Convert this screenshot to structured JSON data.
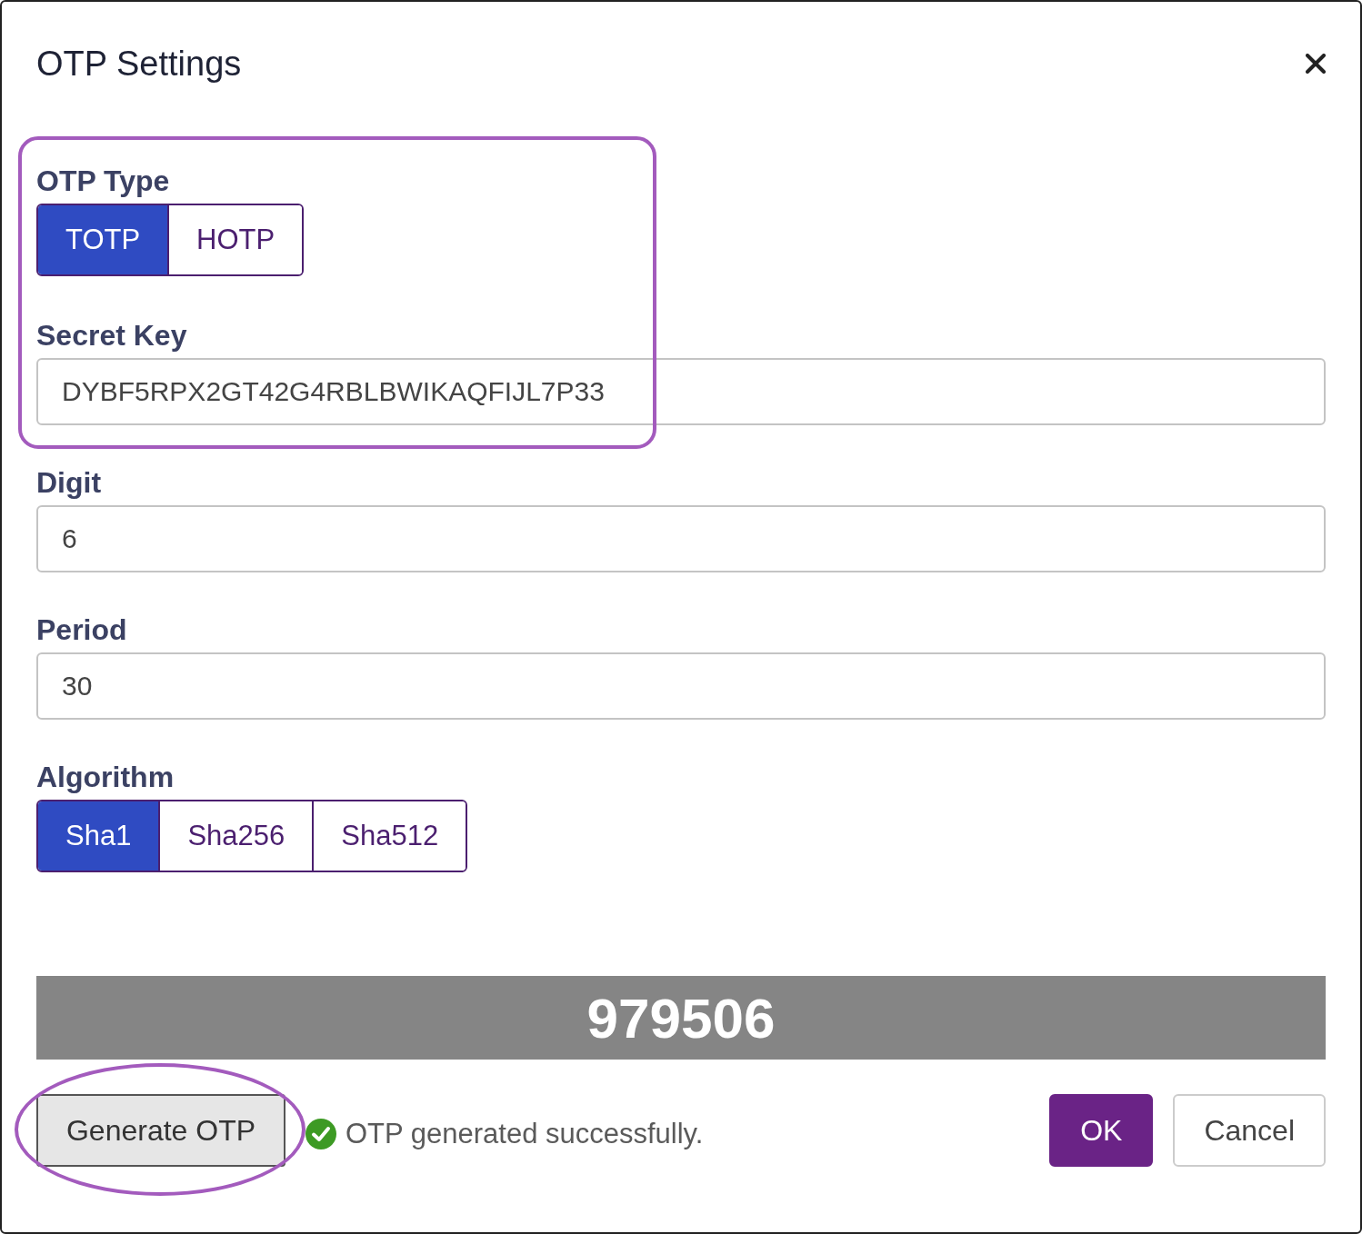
{
  "dialog": {
    "title": "OTP Settings"
  },
  "otp_type": {
    "label": "OTP Type",
    "options": [
      {
        "label": "TOTP",
        "selected": true
      },
      {
        "label": "HOTP",
        "selected": false
      }
    ]
  },
  "fields": [
    {
      "label": "Secret Key",
      "value": "DYBF5RPX2GT42G4RBLBWIKAQFIJL7P33"
    },
    {
      "label": "Digit",
      "value": "6"
    },
    {
      "label": "Period",
      "value": "30"
    }
  ],
  "algorithm": {
    "label": "Algorithm",
    "options": [
      {
        "label": "Sha1",
        "selected": true
      },
      {
        "label": "Sha256",
        "selected": false
      },
      {
        "label": "Sha512",
        "selected": false
      }
    ]
  },
  "otp_value": "979506",
  "footer": {
    "generate_button": "Generate OTP",
    "status": {
      "kind": "success",
      "message": "OTP generated successfully."
    },
    "buttons": [
      {
        "label": "OK",
        "kind": "primary"
      },
      {
        "label": "Cancel",
        "kind": "secondary"
      }
    ]
  }
}
